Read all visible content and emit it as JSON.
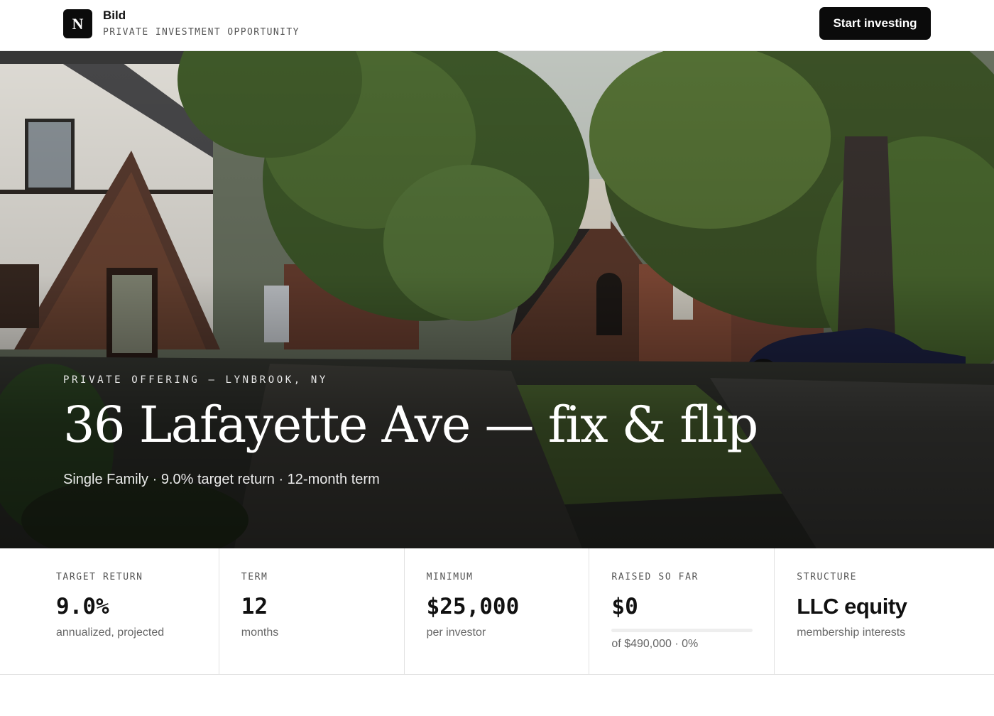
{
  "header": {
    "logo_letter": "N",
    "brand_name": "Bild",
    "brand_subtitle": "PRIVATE INVESTMENT OPPORTUNITY",
    "cta_label": "Start investing"
  },
  "hero": {
    "eyebrow": "PRIVATE OFFERING — LYNBROOK, NY",
    "title": "36 Lafayette Ave — fix & flip",
    "subtitle": "Single Family · 9.0% target return · 12-month term"
  },
  "stats": [
    {
      "label": "TARGET RETURN",
      "value": "9.0%",
      "note": "annualized, projected"
    },
    {
      "label": "TERM",
      "value": "12",
      "note": "months"
    },
    {
      "label": "MINIMUM",
      "value": "$25,000",
      "note": "per investor"
    },
    {
      "label": "RAISED SO FAR",
      "value": "$0",
      "note": "of $490,000 · 0%",
      "progress_fraction": 0
    },
    {
      "label": "STRUCTURE",
      "value": "LLC equity",
      "note": "membership interests"
    }
  ]
}
